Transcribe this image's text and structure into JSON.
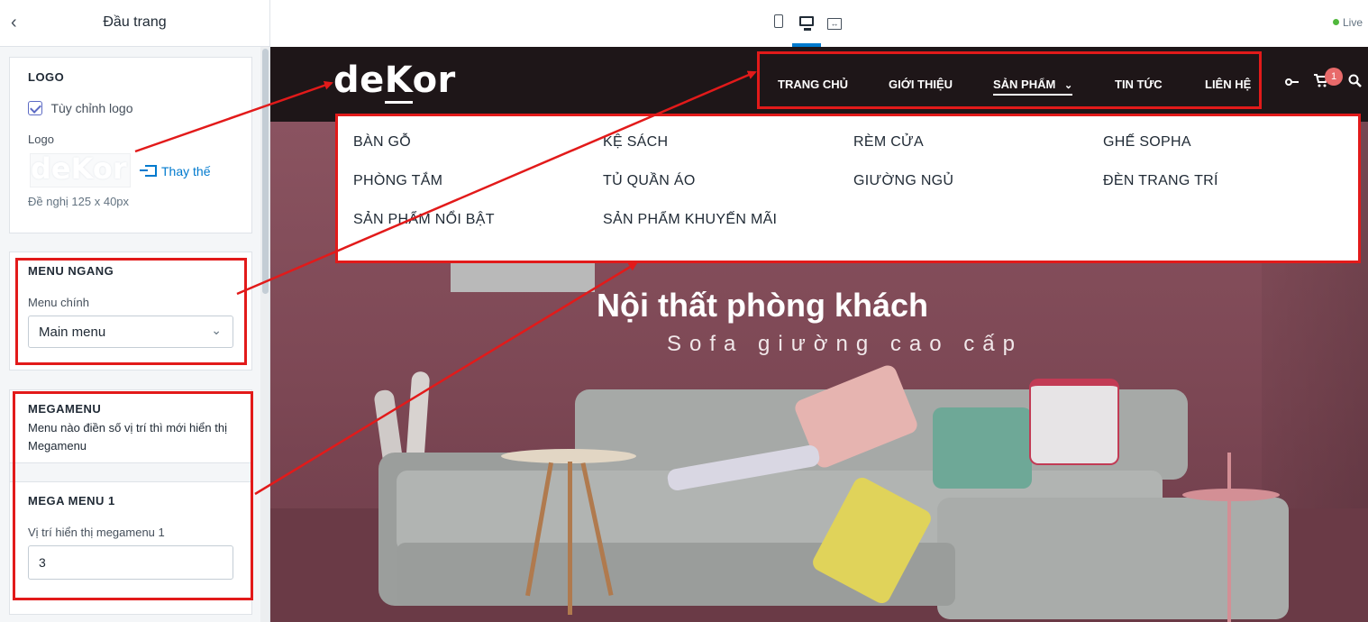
{
  "editor": {
    "title": "Đầu trang",
    "logo_section": {
      "title": "LOGO",
      "checkbox_label": "Tùy chỉnh logo",
      "logo_label": "Logo",
      "logo_thumb_text": "deKor",
      "replace_label": "Thay thế",
      "hint": "Đề nghị 125 x 40px"
    },
    "menu_section": {
      "title": "MENU NGANG",
      "label": "Menu chính",
      "selected": "Main menu"
    },
    "mega_section": {
      "title": "MEGAMENU",
      "description": "Menu nào điền số vị trí thì mới hiển thị Megamenu",
      "sub_title": "MEGA MENU 1",
      "field_label": "Vị trí hiển thị megamenu 1",
      "field_value": "3"
    }
  },
  "toolbar": {
    "live_label": "Live"
  },
  "site": {
    "logo": {
      "pre": "de",
      "mid": "K",
      "post": "or"
    },
    "nav": [
      "TRANG CHỦ",
      "GIỚI THIỆU",
      "SẢN PHẨM",
      "TIN TỨC",
      "LIÊN HỆ"
    ],
    "cart_count": "1",
    "megamenu": [
      [
        "BÀN GỖ",
        "KỆ SÁCH",
        "RÈM CỬA",
        "GHẾ SOPHA"
      ],
      [
        "PHÒNG TẮM",
        "TỦ QUẦN ÁO",
        "GIƯỜNG NGỦ",
        "ĐÈN TRANG TRÍ"
      ],
      [
        "SẢN PHẨM NỔI BẬT",
        "SẢN PHẨM KHUYẾN MÃI"
      ]
    ],
    "hero_title": "Nội thất phòng khách",
    "hero_subtitle": "Sofa giường cao cấp"
  },
  "colors": {
    "annotation": "#e21a1a",
    "header_bg": "#1e1618",
    "wall": "#7d4a55",
    "accent_blue": "#007ace"
  }
}
